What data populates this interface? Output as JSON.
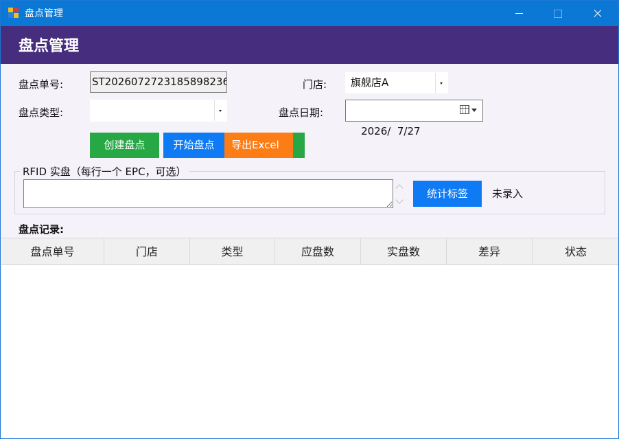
{
  "window": {
    "title": "盘点管理",
    "accent": "#0a78d4"
  },
  "header": {
    "title": "盘点管理",
    "background": "#462d7e"
  },
  "form": {
    "order_no_label": "盘点单号:",
    "order_no_value": "ST2026072723185898236",
    "store_label": "门店:",
    "store_value": "旗舰店A",
    "type_label": "盘点类型:",
    "type_value": "",
    "date_label": "盘点日期:",
    "date_value": "2026/  7/27"
  },
  "actions": {
    "create_label": "创建盘点",
    "start_label": "开始盘点",
    "export_label": "导出Excel",
    "colors": {
      "create": "#27a844",
      "start": "#0e7bf5",
      "export": "#fc7d16"
    }
  },
  "rfid": {
    "legend": "RFID 实盘（每行一个 EPC，可选）",
    "epc_value": "",
    "count_button_label": "统计标签",
    "status_text": "未录入"
  },
  "records": {
    "label": "盘点记录:",
    "columns": [
      "盘点单号",
      "门店",
      "类型",
      "应盘数",
      "实盘数",
      "差异",
      "状态"
    ],
    "rows": []
  },
  "icons": [
    "app-icon",
    "minimize-icon",
    "maximize-icon",
    "close-icon",
    "calendar-icon",
    "chevron-down-icon"
  ]
}
